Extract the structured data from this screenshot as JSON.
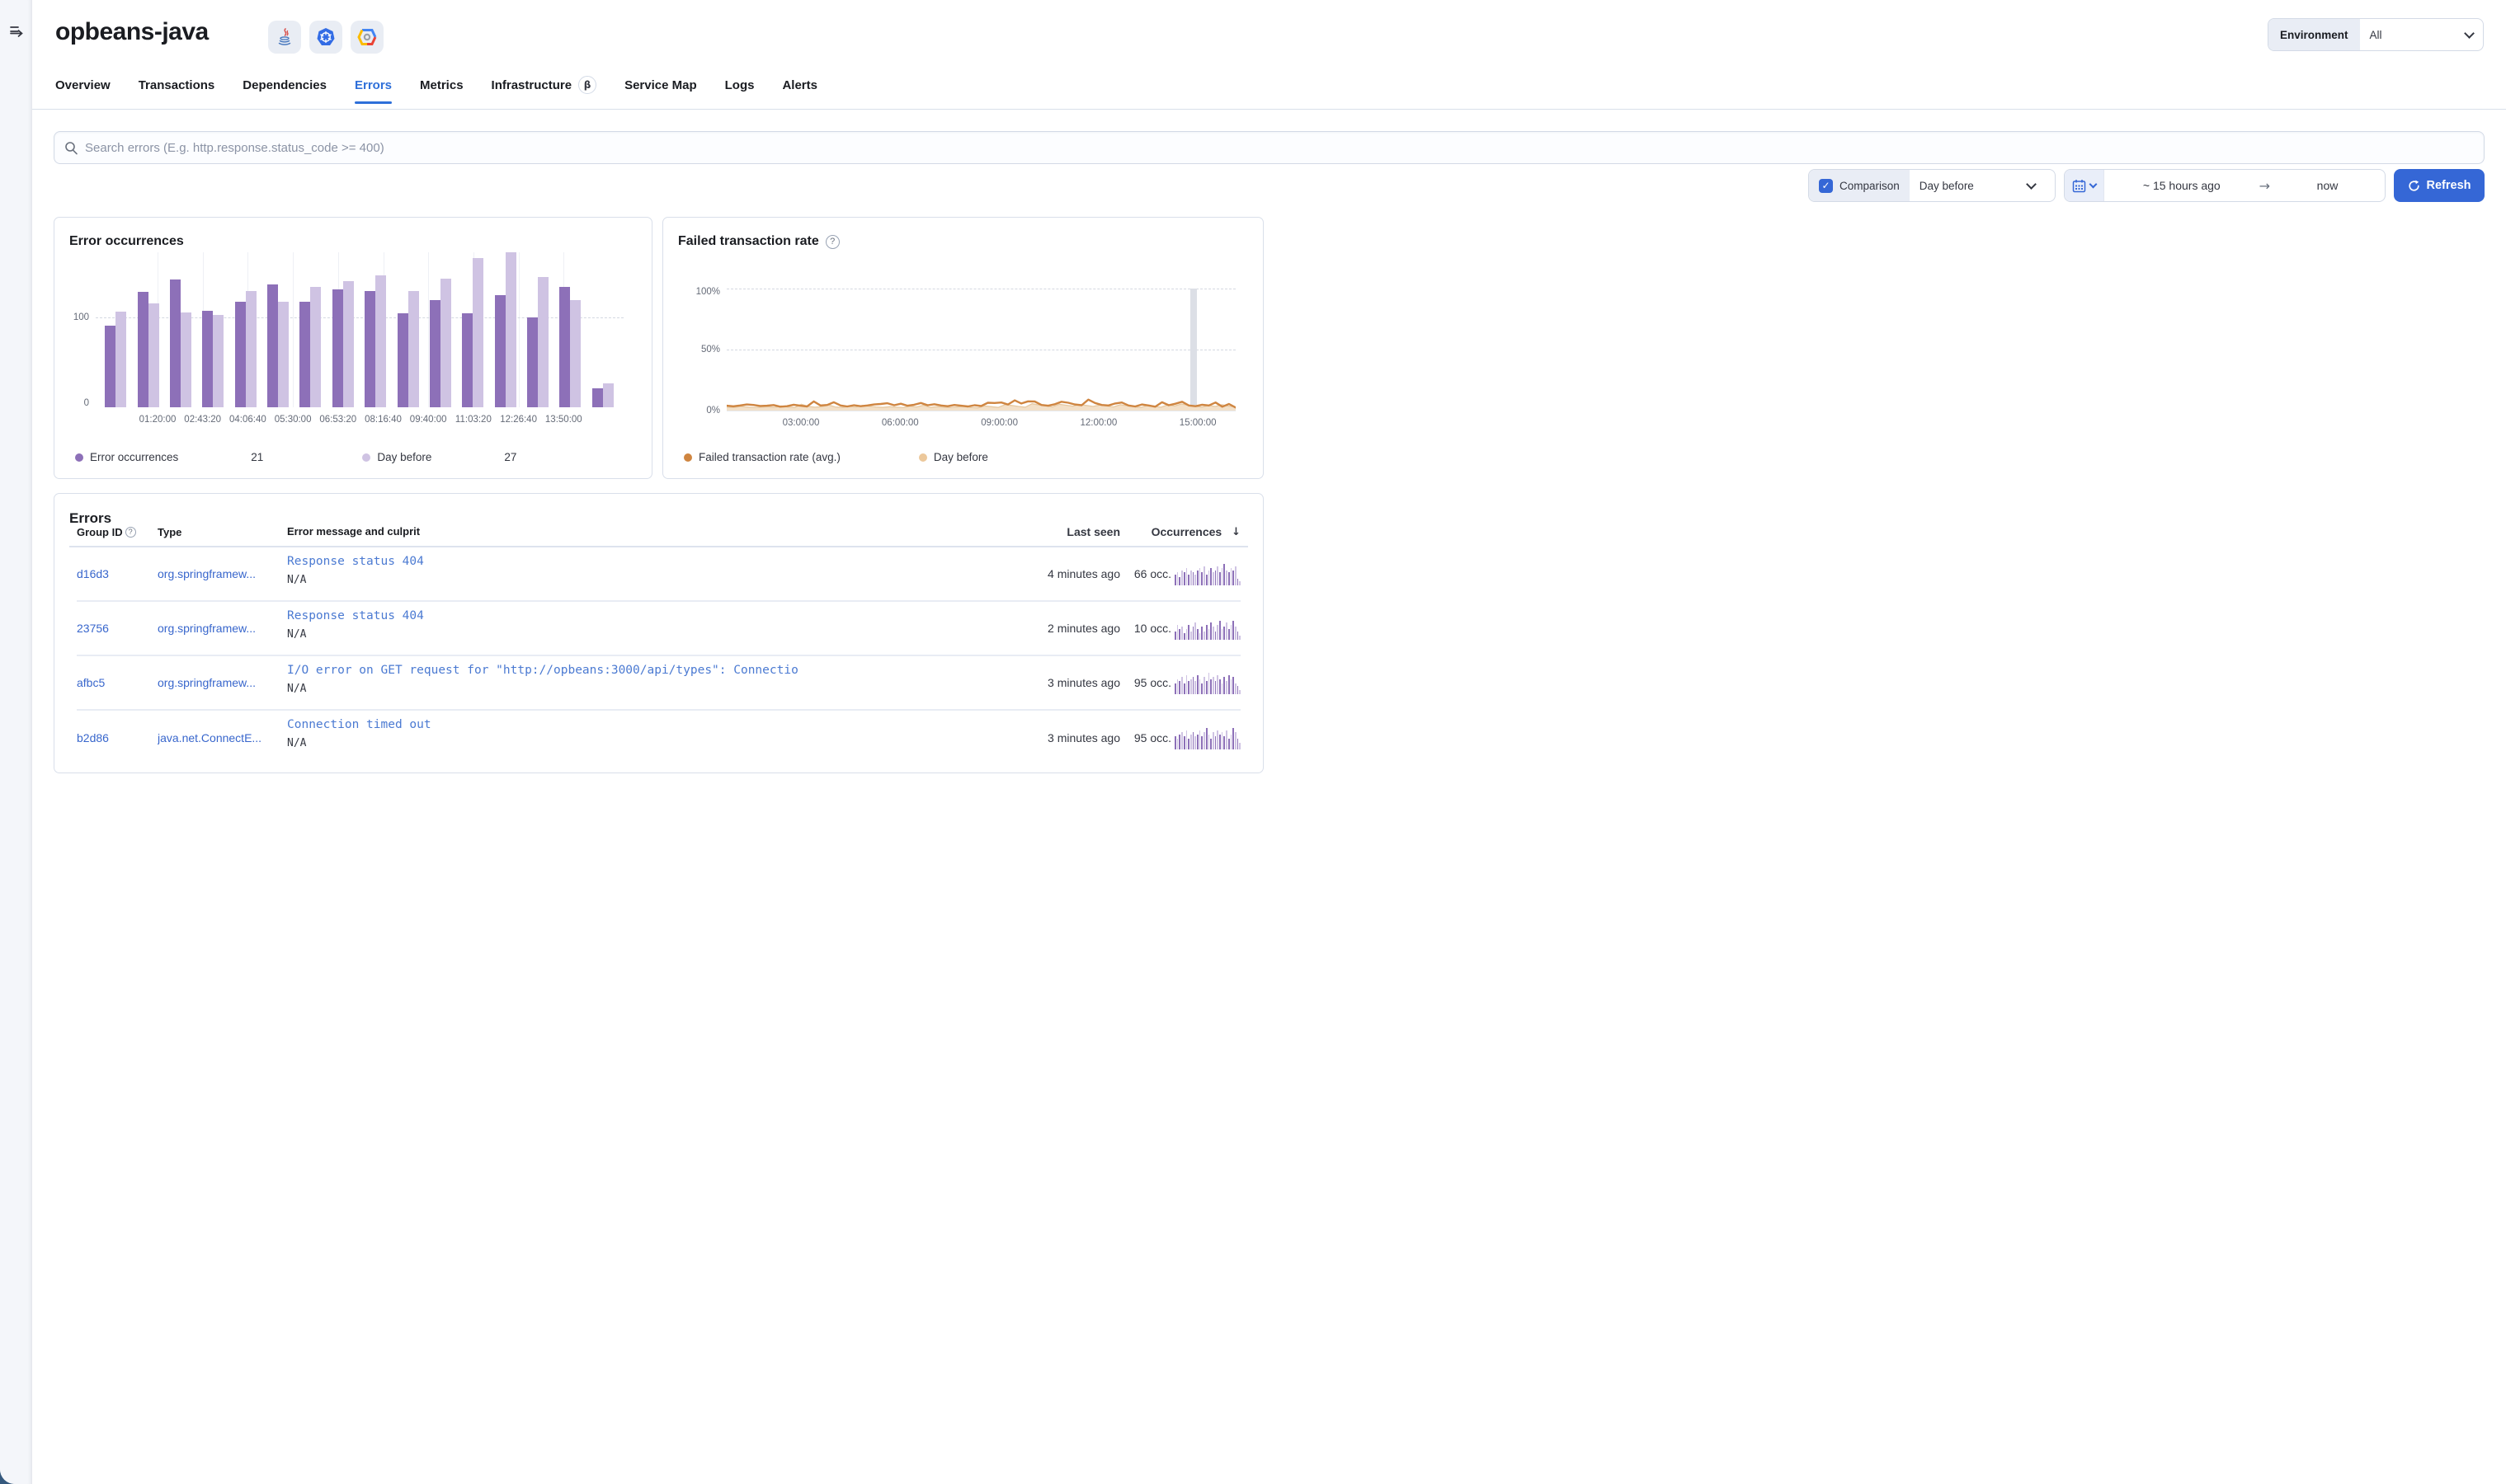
{
  "chrome": {
    "expand_tooltip": "Expand navigation"
  },
  "header": {
    "title": "opbeans-java",
    "badges": [
      {
        "name": "java"
      },
      {
        "name": "kubernetes"
      },
      {
        "name": "google-cloud"
      }
    ],
    "environment": {
      "label": "Environment",
      "value": "All"
    }
  },
  "tabs": [
    {
      "label": "Overview"
    },
    {
      "label": "Transactions"
    },
    {
      "label": "Dependencies"
    },
    {
      "label": "Errors",
      "active": true
    },
    {
      "label": "Metrics"
    },
    {
      "label": "Infrastructure",
      "beta": "β"
    },
    {
      "label": "Service Map"
    },
    {
      "label": "Logs"
    },
    {
      "label": "Alerts"
    }
  ],
  "search": {
    "placeholder": "Search errors (E.g. http.response.status_code >= 400)"
  },
  "controls": {
    "comparison_label": "Comparison",
    "comparison_checked": true,
    "check_glyph": "✓",
    "comparison_value": "Day before",
    "time_start": "~ 15 hours ago",
    "time_arrow": "→",
    "time_end": "now",
    "refresh_label": "Refresh"
  },
  "chart_data": [
    {
      "type": "bar",
      "title": "Error occurrences",
      "ylim": [
        0,
        173
      ],
      "yticks": [
        {
          "value": 100,
          "label": "100"
        },
        {
          "value": 0,
          "label": "0"
        }
      ],
      "xticks": [
        "01:20:00",
        "02:43:20",
        "04:06:40",
        "05:30:00",
        "06:53:20",
        "08:16:40",
        "09:40:00",
        "11:03:20",
        "12:26:40",
        "13:50:00"
      ],
      "series": [
        {
          "name": "Error occurrences",
          "color": "#8d70b8",
          "values": [
            91,
            129,
            143,
            108,
            118,
            137,
            118,
            132,
            130,
            105,
            120,
            105,
            125,
            100,
            134,
            21
          ]
        },
        {
          "name": "Day before",
          "color": "#cfc3e3",
          "values": [
            107,
            116,
            106,
            103,
            130,
            118,
            134,
            141,
            147,
            130,
            144,
            167,
            173,
            145,
            120,
            27
          ]
        }
      ],
      "legend": [
        {
          "label": "Error occurrences",
          "value": "21",
          "color": "#8d70b8"
        },
        {
          "label": "Day before",
          "value": "27",
          "color": "#cfc3e3"
        }
      ]
    },
    {
      "type": "area",
      "title": "Failed transaction rate",
      "ylim": [
        0,
        100
      ],
      "yticks": [
        {
          "value": 100,
          "label": "100%"
        },
        {
          "value": 50,
          "label": "50%"
        },
        {
          "value": 0,
          "label": "0%"
        }
      ],
      "xticks": [
        "03:00:00",
        "06:00:00",
        "09:00:00",
        "12:00:00",
        "15:00:00"
      ],
      "series": [
        {
          "name": "Failed transaction rate (avg.)",
          "color": "#cf8540",
          "style": "line",
          "values": [
            4,
            3.5,
            4.2,
            5,
            4.6,
            3.8,
            4,
            4.5,
            3.2,
            3.6,
            4.8,
            4,
            3.4,
            7.5,
            4.2,
            4.6,
            6.8,
            4.2,
            3.4,
            4.4,
            3.6,
            4.2,
            5,
            5.4,
            6,
            4.4,
            5.6,
            4,
            4.8,
            6.2,
            4.4,
            5.2,
            4.2,
            3.6,
            4.6,
            4,
            3.4,
            4.4,
            3.8,
            6.4,
            6.2,
            6.6,
            5,
            8.4,
            5.8,
            7.6,
            7.4,
            4.6,
            4,
            5.2,
            7.2,
            6.4,
            5,
            4.4,
            9,
            6.2,
            4.6,
            4.2,
            5.8,
            6.6,
            4.2,
            3.4,
            5,
            4.2,
            3.2,
            6.8,
            4.4,
            5.6,
            7.2,
            4.2,
            3.6,
            4.8,
            4.2,
            6.6,
            3.2,
            5.4,
            2.5
          ]
        },
        {
          "name": "Day before",
          "color": "#f3e0c8",
          "style": "area",
          "values": [
            3,
            2.6,
            3.4,
            3,
            2.4,
            2.8,
            3.2,
            2.6,
            3.8,
            3,
            2.4,
            5.2,
            3.4,
            2.8,
            3.2,
            4.6,
            3,
            2.6,
            3.4,
            2.8,
            4.2,
            3.6,
            3,
            2.6,
            3.2,
            2.8,
            2.4,
            3.6,
            3,
            4.4,
            2.6,
            3.2,
            2.8,
            2.4,
            3,
            3.4,
            2.6,
            2.2,
            3.8,
            3.2,
            2.6,
            4.8,
            4.2,
            3.4,
            2.8,
            5.6,
            4.6,
            3.8,
            3,
            5.2,
            4.4,
            3.6,
            5,
            4.2,
            3.4,
            4.6,
            3.8,
            3,
            4.8,
            4,
            3.2,
            2.6,
            4.2,
            3.4,
            2.8,
            4.6,
            3.8,
            5.4,
            4.4,
            3.6,
            2.8,
            4.2,
            3.4,
            4.8,
            3.6,
            3
          ]
        }
      ],
      "legend": [
        {
          "label": "Failed transaction rate (avg.)",
          "value": "",
          "color": "#cf8540"
        },
        {
          "label": "Day before",
          "value": "",
          "color": "#ecc89b"
        }
      ],
      "annotation": {
        "note": "current-bucket-highlight"
      }
    }
  ],
  "errors_table": {
    "title": "Errors",
    "columns": {
      "group_id": "Group ID",
      "type": "Type",
      "message": "Error message and culprit",
      "last_seen": "Last seen",
      "occurrences": "Occurrences"
    },
    "sort_arrow": "↓",
    "rows": [
      {
        "group_id": "d16d3",
        "type": "org.springframew...",
        "message": "Response status 404",
        "culprit": "N/A",
        "last_seen": "4 minutes ago",
        "occurrences": "66 occ.",
        "spark": [
          5,
          6,
          4,
          7,
          6,
          8,
          5,
          7,
          6,
          5,
          7,
          8,
          6,
          9,
          5,
          7,
          8,
          6,
          7,
          9,
          6,
          8,
          10,
          7,
          6,
          8,
          7,
          9,
          3,
          2
        ]
      },
      {
        "group_id": "23756",
        "type": "org.springframew...",
        "message": "Response status 404",
        "culprit": "N/A",
        "last_seen": "2 minutes ago",
        "occurrences": "10 occ.",
        "spark": [
          4,
          7,
          5,
          6,
          3,
          5,
          7,
          4,
          6,
          8,
          5,
          3,
          6,
          4,
          7,
          5,
          8,
          6,
          4,
          7,
          9,
          5,
          6,
          8,
          5,
          7,
          9,
          6,
          4,
          2
        ]
      },
      {
        "group_id": "afbc5",
        "type": "org.springframew...",
        "message": "I/O error on GET request for \"http://opbeans:3000/api/types\": Connectio",
        "culprit": "N/A",
        "last_seen": "3 minutes ago",
        "occurrences": "95 occ.",
        "spark": [
          5,
          7,
          6,
          8,
          5,
          9,
          6,
          7,
          8,
          6,
          9,
          7,
          5,
          8,
          6,
          10,
          7,
          8,
          6,
          9,
          7,
          5,
          8,
          6,
          9,
          7,
          8,
          5,
          4,
          2
        ]
      },
      {
        "group_id": "b2d86",
        "type": "java.net.ConnectE...",
        "message": "Connection timed out",
        "culprit": "N/A",
        "last_seen": "3 minutes ago",
        "occurrences": "95 occ.",
        "spark": [
          6,
          5,
          7,
          8,
          6,
          9,
          5,
          7,
          8,
          6,
          7,
          9,
          6,
          8,
          10,
          7,
          5,
          8,
          6,
          9,
          7,
          8,
          6,
          9,
          5,
          7,
          10,
          8,
          5,
          3
        ]
      }
    ]
  }
}
